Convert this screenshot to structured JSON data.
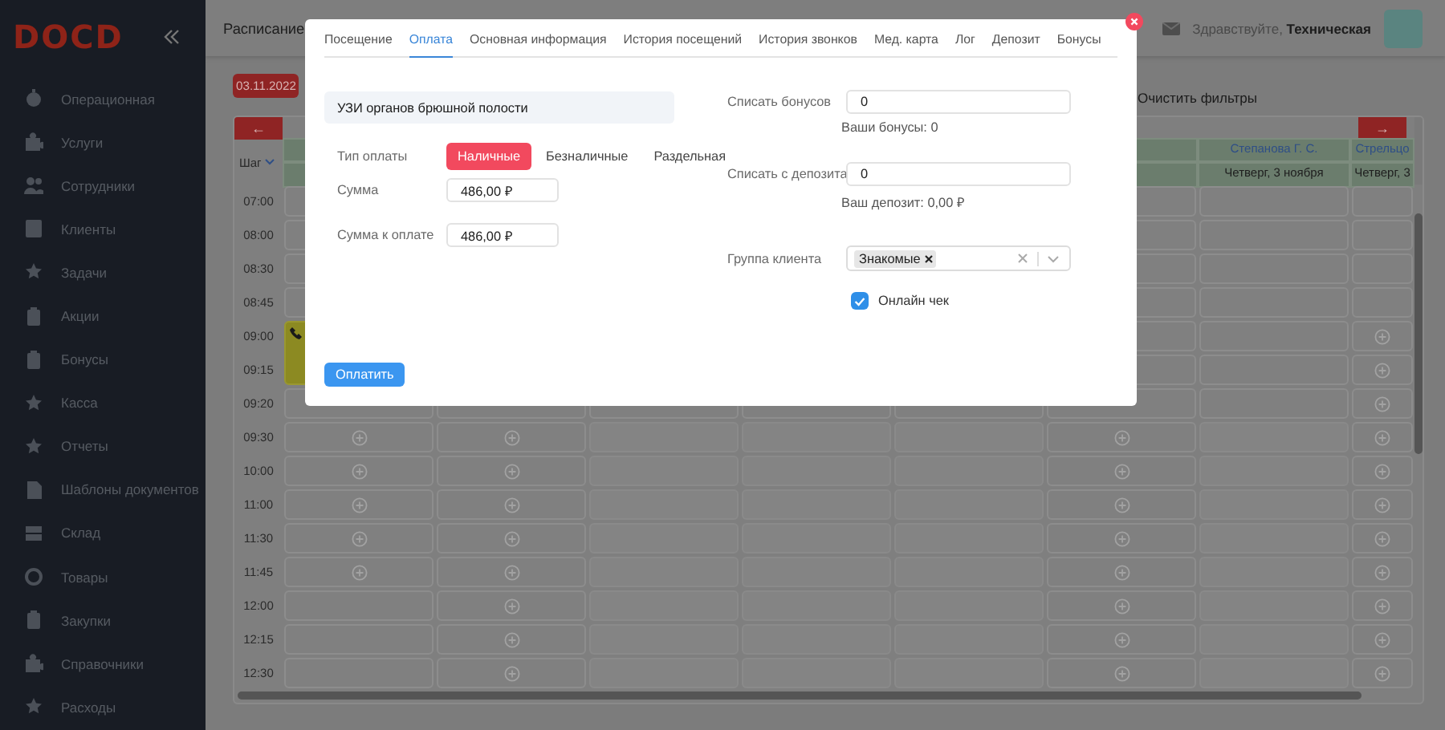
{
  "sidebar": {
    "logo": "DOCD",
    "items": [
      "Операционная",
      "Услуги",
      "Сотрудники",
      "Клиенты",
      "Задачи",
      "Акции",
      "Бонусы",
      "Касса",
      "Отчеты",
      "Шаблоны документов",
      "Склад",
      "Товары",
      "Закупки",
      "Справочники",
      "Расходы"
    ]
  },
  "header": {
    "title": "Расписание",
    "greeting": "Здравствуйте,",
    "user": "Техническая"
  },
  "toolbar": {
    "date": "03.11.2022",
    "clear_filters": "Очистить фильтры"
  },
  "schedule": {
    "prev": "←",
    "next": "→",
    "step_label": "Шаг",
    "columns": [
      {},
      null,
      null,
      null,
      null,
      {},
      {
        "header": "Степанова Г. С.",
        "date": "Четверг, 3 ноября"
      },
      {
        "header": "Стрельцо",
        "date": "Четверг, 3"
      }
    ],
    "rows": [
      {
        "time": "07:00",
        "cells": [
          {
            "kind": "slot"
          },
          null,
          null,
          null,
          null,
          {
            "kind": "slot"
          },
          {
            "kind": "slot"
          },
          {
            "kind": "slot"
          }
        ]
      },
      {
        "time": "08:00",
        "cells": [
          {
            "kind": "slot"
          },
          null,
          null,
          null,
          null,
          {
            "kind": "slot"
          },
          {
            "kind": "slot"
          },
          {
            "kind": "slot"
          }
        ]
      },
      {
        "time": "08:30",
        "cells": [
          {
            "kind": "slot"
          },
          null,
          null,
          null,
          null,
          {
            "kind": "slot"
          },
          {
            "kind": "slot"
          },
          {
            "kind": "slot"
          }
        ]
      },
      {
        "time": "08:45",
        "cells": [
          {
            "kind": "slot"
          },
          null,
          null,
          null,
          null,
          {
            "kind": "slot"
          },
          {
            "kind": "slot"
          },
          {
            "kind": "slot"
          }
        ]
      },
      {
        "time": "09:00",
        "cells": [
          {
            "kind": "event"
          },
          null,
          null,
          null,
          null,
          {
            "kind": "slot"
          },
          {
            "kind": "slot"
          },
          {
            "kind": "add"
          }
        ]
      },
      {
        "time": "09:15",
        "cells": [
          {
            "kind": "event"
          },
          null,
          null,
          null,
          null,
          {
            "kind": "slot"
          },
          {
            "kind": "slot"
          },
          {
            "kind": "add"
          }
        ]
      },
      {
        "time": "09:20",
        "cells": [
          {
            "kind": "slot"
          },
          {
            "kind": "slot"
          },
          {
            "kind": "slot"
          },
          {
            "kind": "slot"
          },
          {
            "kind": "slot"
          },
          {
            "kind": "slot"
          },
          {
            "kind": "slot"
          },
          {
            "kind": "add"
          }
        ]
      },
      {
        "time": "09:30",
        "cells": [
          {
            "kind": "add"
          },
          {
            "kind": "add"
          },
          {
            "kind": "blank"
          },
          {
            "kind": "blank"
          },
          {
            "kind": "blank"
          },
          {
            "kind": "add"
          },
          {
            "kind": "blank"
          },
          {
            "kind": "add"
          }
        ]
      },
      {
        "time": "10:00",
        "cells": [
          {
            "kind": "add"
          },
          {
            "kind": "add"
          },
          {
            "kind": "blank"
          },
          {
            "kind": "blank"
          },
          {
            "kind": "blank"
          },
          {
            "kind": "add"
          },
          {
            "kind": "blank"
          },
          {
            "kind": "add"
          }
        ]
      },
      {
        "time": "11:00",
        "cells": [
          {
            "kind": "add"
          },
          {
            "kind": "add"
          },
          {
            "kind": "blank"
          },
          {
            "kind": "blank"
          },
          {
            "kind": "blank"
          },
          {
            "kind": "add"
          },
          {
            "kind": "blank"
          },
          {
            "kind": "add"
          }
        ]
      },
      {
        "time": "11:30",
        "cells": [
          {
            "kind": "add"
          },
          {
            "kind": "add"
          },
          {
            "kind": "blank"
          },
          {
            "kind": "blank"
          },
          {
            "kind": "blank"
          },
          {
            "kind": "add"
          },
          {
            "kind": "blank"
          },
          {
            "kind": "add"
          }
        ]
      },
      {
        "time": "11:45",
        "cells": [
          {
            "kind": "add"
          },
          {
            "kind": "add"
          },
          {
            "kind": "blank"
          },
          {
            "kind": "blank"
          },
          {
            "kind": "blank"
          },
          {
            "kind": "add"
          },
          {
            "kind": "blank"
          },
          {
            "kind": "add"
          }
        ]
      },
      {
        "time": "12:00",
        "cells": [
          {
            "kind": "slot"
          },
          {
            "kind": "add"
          },
          {
            "kind": "blank"
          },
          {
            "kind": "blank"
          },
          {
            "kind": "blank"
          },
          {
            "kind": "add"
          },
          {
            "kind": "blank"
          },
          {
            "kind": "add"
          }
        ]
      },
      {
        "time": "12:15",
        "cells": [
          {
            "kind": "slot"
          },
          {
            "kind": "add"
          },
          {
            "kind": "blank"
          },
          {
            "kind": "blank"
          },
          {
            "kind": "blank"
          },
          {
            "kind": "add"
          },
          {
            "kind": "blank"
          },
          {
            "kind": "add"
          }
        ]
      },
      {
        "time": "12:30",
        "cells": [
          {
            "kind": "slot"
          },
          {
            "kind": "add"
          },
          {
            "kind": "blank"
          },
          {
            "kind": "blank"
          },
          {
            "kind": "blank"
          },
          {
            "kind": "add"
          },
          {
            "kind": "blank"
          },
          {
            "kind": "add"
          }
        ]
      }
    ]
  },
  "modal": {
    "tabs": [
      {
        "label": "Посещение",
        "selected": false
      },
      {
        "label": "Оплата",
        "selected": true
      },
      {
        "label": "Основная информация",
        "selected": false
      },
      {
        "label": "История посещений",
        "selected": false
      },
      {
        "label": "История звонков",
        "selected": false
      },
      {
        "label": "Мед. карта",
        "selected": false
      },
      {
        "label": "Лог",
        "selected": false
      },
      {
        "label": "Депозит",
        "selected": false
      },
      {
        "label": "Бонусы",
        "selected": false
      }
    ],
    "service": "УЗИ органов брюшной полости",
    "payment_type": {
      "label": "Тип оплаты",
      "options": [
        {
          "label": "Наличные",
          "selected": true
        },
        {
          "label": "Безналичные",
          "selected": false
        },
        {
          "label": "Раздельная",
          "selected": false
        }
      ]
    },
    "amount": {
      "label": "Сумма",
      "value": "486,00 ₽"
    },
    "amount_due": {
      "label": "Сумма к оплате",
      "value": "486,00 ₽"
    },
    "bonuses": {
      "label": "Списать бонусов",
      "value": "0",
      "hint": "Ваши бонусы: 0"
    },
    "deposit": {
      "label": "Списать с депозита",
      "value": "0",
      "hint": "Ваш депозит: 0,00 ₽"
    },
    "client_group": {
      "label": "Группа клиента",
      "tags": [
        "Знакомые"
      ]
    },
    "online_receipt": {
      "label": "Онлайн чек",
      "checked": true
    },
    "pay_button": "Оплатить"
  }
}
